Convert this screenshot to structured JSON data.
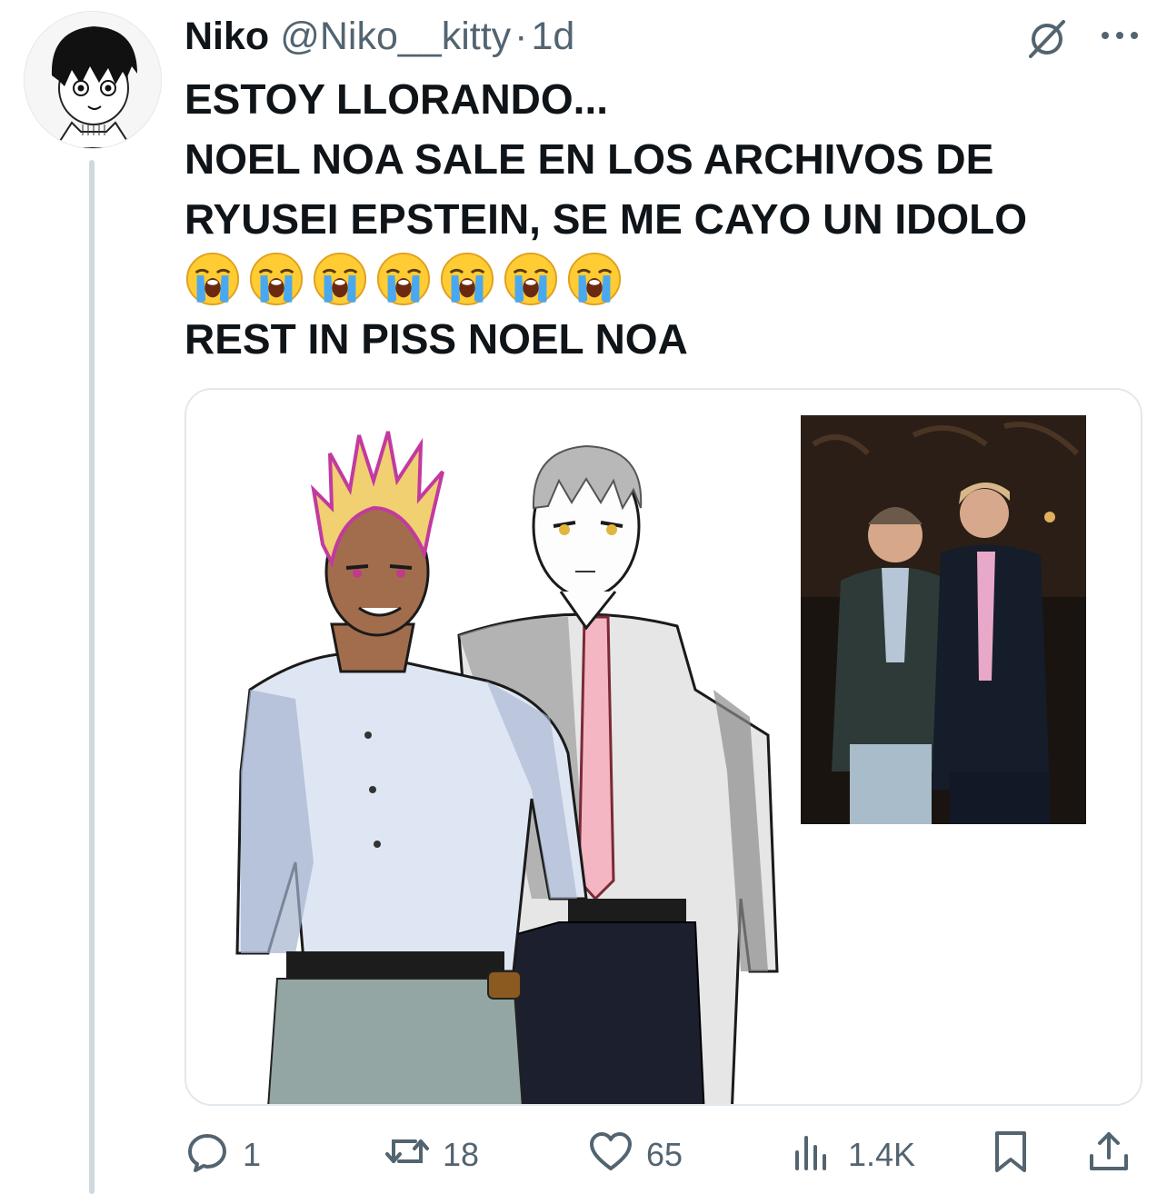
{
  "tweet": {
    "author_name": "Niko",
    "handle": "@Niko__kitty",
    "separator": "·",
    "time": "1d",
    "text_lines": [
      "ESTOY LLORANDO...",
      "NOEL NOA SALE EN LOS ARCHIVOS DE",
      "RYUSEI EPSTEIN, SE ME CAYO UN IDOLO"
    ],
    "emoji_name": "loudly-crying-face",
    "emoji_count": 7,
    "last_line": "REST IN PISS NOEL NOA",
    "media": {
      "description_icon": "image"
    }
  },
  "actions": {
    "replies": "1",
    "reposts": "18",
    "likes": "65",
    "views": "1.4K"
  },
  "colors": {
    "text": "#0f1419",
    "secondary": "#536471",
    "border": "#e1e8ed",
    "thread_line": "#cfd9de"
  }
}
